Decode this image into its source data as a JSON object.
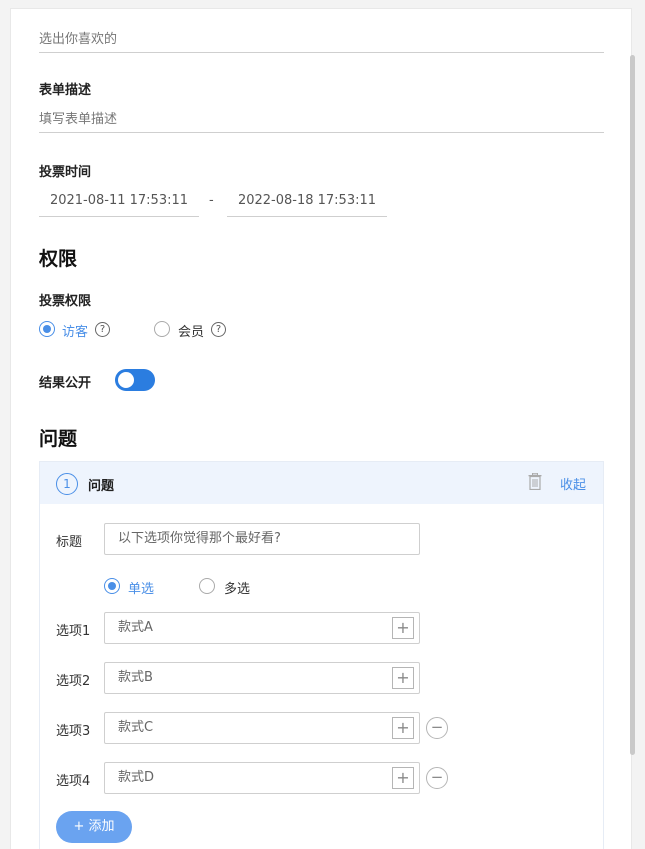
{
  "form": {
    "subtitle_value": "选出你喜欢的",
    "desc_label": "表单描述",
    "desc_placeholder": "填写表单描述",
    "time_label": "投票时间",
    "start_time": "2021-08-11 17:53:11",
    "dash": "-",
    "end_time": "2022-08-18 17:53:11"
  },
  "permissions": {
    "heading": "权限",
    "vote_perm_label": "投票权限",
    "options": [
      {
        "label": "访客",
        "selected": true
      },
      {
        "label": "会员",
        "selected": false
      }
    ],
    "help_glyph": "?",
    "public_label": "结果公开",
    "public_on": true
  },
  "questions": {
    "heading": "问题",
    "items": [
      {
        "number": "1",
        "title": "问题",
        "collapse_label": "收起",
        "title_label": "标题",
        "title_value": "以下选项你觉得那个最好看?",
        "modes": [
          {
            "label": "单选",
            "selected": true
          },
          {
            "label": "多选",
            "selected": false
          }
        ],
        "options": [
          {
            "label": "选项1",
            "value": "款式A",
            "removable": false
          },
          {
            "label": "选项2",
            "value": "款式B",
            "removable": false
          },
          {
            "label": "选项3",
            "value": "款式C",
            "removable": true
          },
          {
            "label": "选项4",
            "value": "款式D",
            "removable": true
          }
        ],
        "plus_glyph": "+",
        "minus_glyph": "−",
        "add_label": "+ 添加"
      }
    ]
  },
  "colors": {
    "accent": "#4a8fe7",
    "toggle_on": "#2b7de0",
    "add_button": "#6aa3f0",
    "panel_header": "#eef4fd"
  }
}
